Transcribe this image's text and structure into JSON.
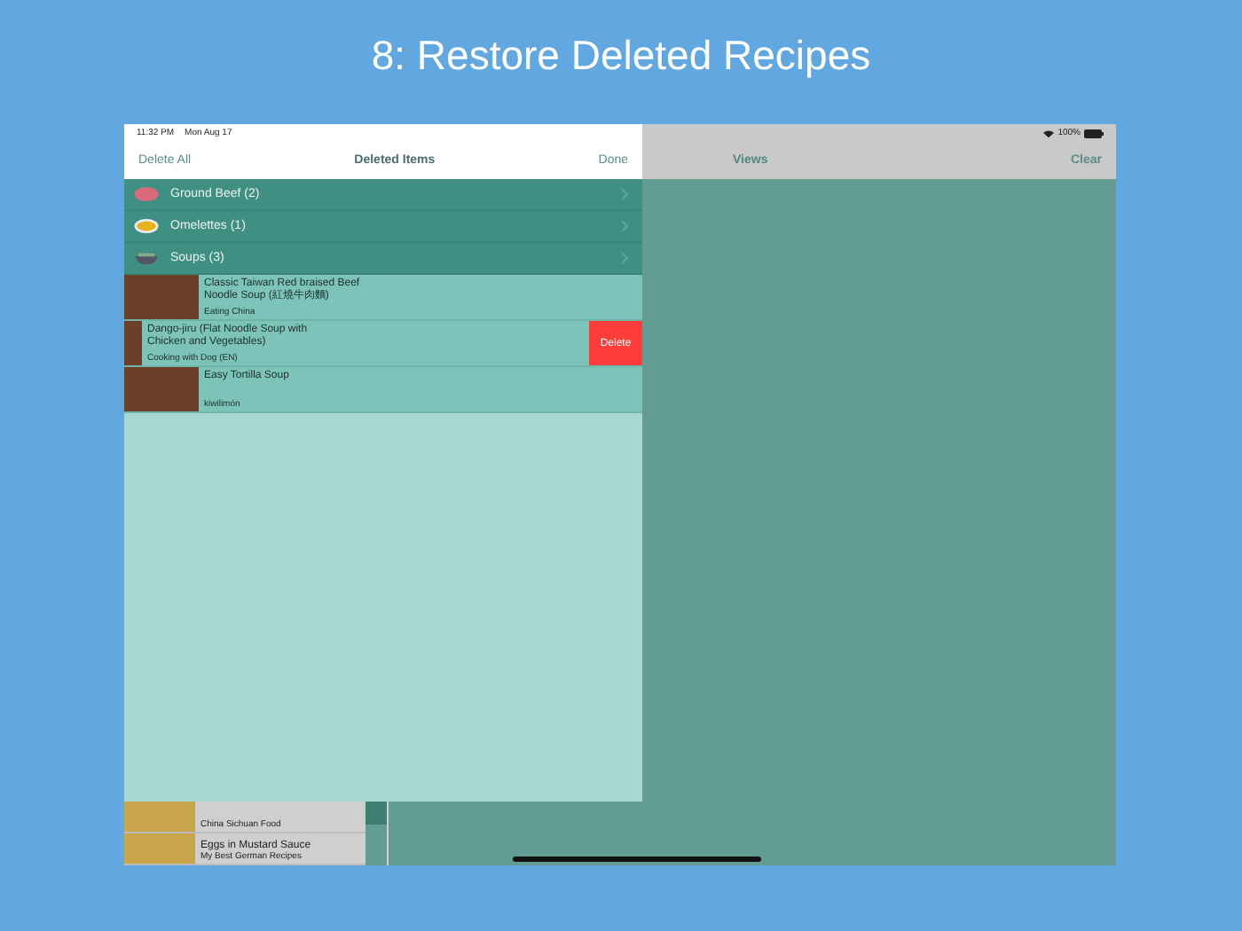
{
  "title": "8: Restore Deleted Recipes",
  "status_bar": {
    "time": "11:32 PM",
    "date": "Mon Aug 17",
    "battery": "100%"
  },
  "left_nav": {
    "left_button": "Delete All",
    "title": "Deleted Items",
    "right_button": "Done"
  },
  "right_nav": {
    "title": "Views",
    "right_button": "Clear"
  },
  "categories": [
    {
      "name": "Ground Beef (2)",
      "kind": "beef"
    },
    {
      "name": "Omelettes (1)",
      "kind": "omelette"
    },
    {
      "name": "Soups (3)",
      "kind": "soup",
      "children": [
        {
          "title": "Classic Taiwan Red braised Beef Noodle Soup (紅燒牛肉麵)",
          "source": "Eating China",
          "swiped": false
        },
        {
          "title": "Dango-jiru (Flat Noodle Soup with Chicken and Vegetables)",
          "source": "Cooking with Dog (EN)",
          "swiped": true
        },
        {
          "title": "Easy Tortilla Soup",
          "source": "kiwilimón",
          "swiped": false
        }
      ]
    }
  ],
  "delete_label": "Delete",
  "background_list": [
    {
      "source": "China Sichuan Food"
    },
    {
      "title": "Eggs in Mustard Sauce",
      "source": "My Best German Recipes"
    }
  ]
}
